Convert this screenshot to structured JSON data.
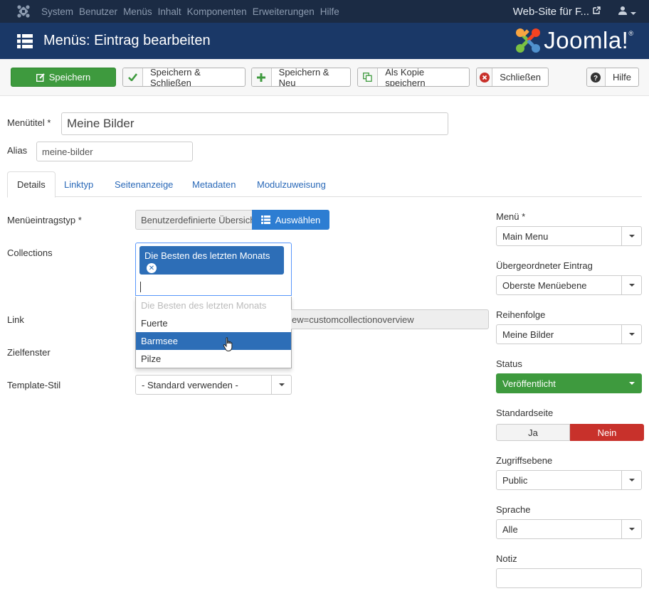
{
  "topbar": {
    "menu": [
      "System",
      "Benutzer",
      "Menüs",
      "Inhalt",
      "Komponenten",
      "Erweiterungen",
      "Hilfe"
    ],
    "site_link": "Web-Site für F...",
    "icons": {
      "logo": "joomla-icon",
      "external": "external-link-icon",
      "user": "user-icon"
    }
  },
  "header": {
    "title": "Menüs: Eintrag bearbeiten",
    "brand": "Joomla!"
  },
  "toolbar": {
    "save": "Speichern",
    "save_close": "Speichern & Schließen",
    "save_new": "Speichern & Neu",
    "save_copy": "Als Kopie speichern",
    "close": "Schließen",
    "help": "Hilfe"
  },
  "form": {
    "menu_title_label": "Menütitel *",
    "menu_title_value": "Meine Bilder",
    "alias_label": "Alias",
    "alias_value": "meine-bilder"
  },
  "tabs": [
    "Details",
    "Linktyp",
    "Seitenanzeige",
    "Metadaten",
    "Modulzuweisung"
  ],
  "details": {
    "type_label": "Menüeintragstyp *",
    "type_value": "Benutzerdefinierte Übersicht",
    "select_button": "Auswählen",
    "collections_label": "Collections",
    "collections_selected": [
      "Die Besten des letzten Monats"
    ],
    "collections_options": [
      {
        "label": "Die Besten des letzten Monats",
        "state": "disabled"
      },
      {
        "label": "Fuerte",
        "state": "normal"
      },
      {
        "label": "Barmsee",
        "state": "highlighted"
      },
      {
        "label": "Pilze",
        "state": "normal"
      }
    ],
    "link_label": "Link",
    "link_value": "ew=customcollectionoverview",
    "target_label": "Zielfenster",
    "template_label": "Template-Stil",
    "template_value": "- Standard verwenden -"
  },
  "sidebar": {
    "menu_label": "Menü *",
    "menu_value": "Main Menu",
    "parent_label": "Übergeordneter Eintrag",
    "parent_value": "Oberste Menüebene",
    "order_label": "Reihenfolge",
    "order_value": "Meine Bilder",
    "status_label": "Status",
    "status_value": "Veröffentlicht",
    "default_label": "Standardseite",
    "default_yes": "Ja",
    "default_no": "Nein",
    "access_label": "Zugriffsebene",
    "access_value": "Public",
    "language_label": "Sprache",
    "language_value": "Alle",
    "note_label": "Notiz",
    "note_value": ""
  },
  "colors": {
    "topbar": "#1b2b44",
    "header": "#1a3867",
    "primary_green": "#3e9a3e",
    "accent_blue": "#2d7dd2",
    "selection_blue": "#2d6eb7",
    "danger_red": "#c8312b"
  }
}
